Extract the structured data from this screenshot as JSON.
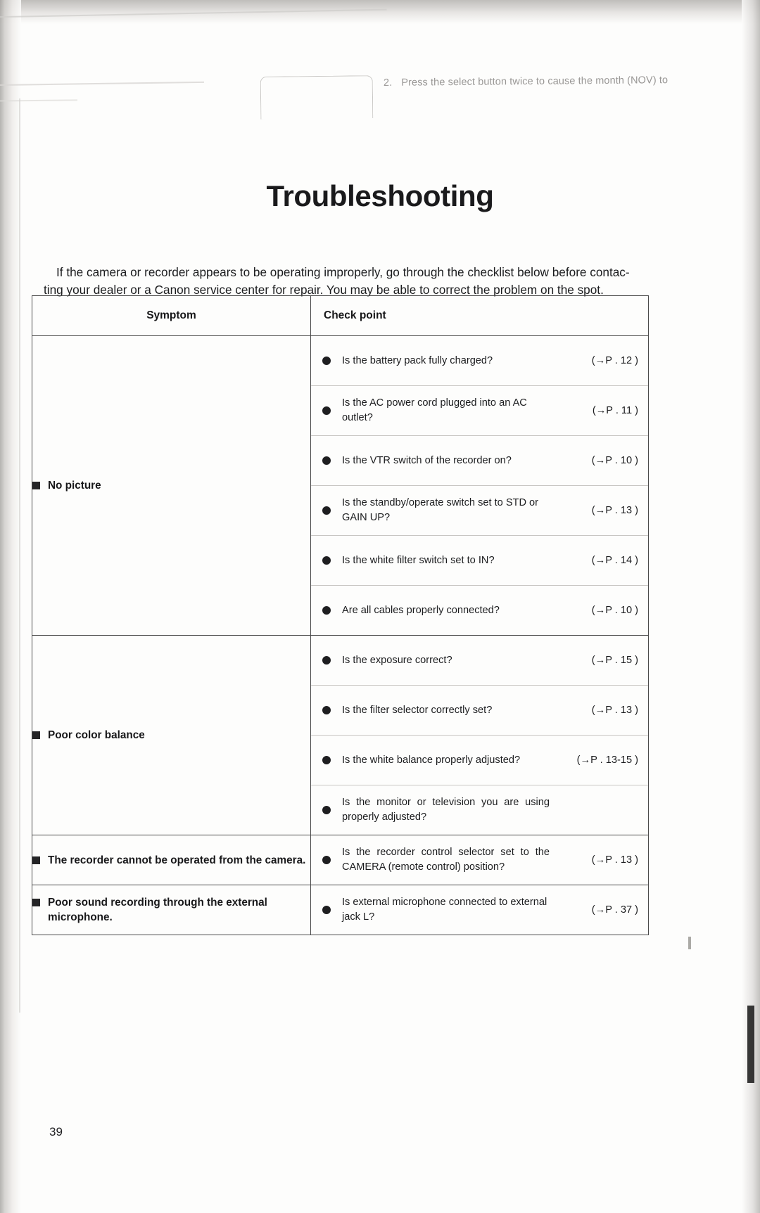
{
  "document": {
    "title": "Troubleshooting",
    "page_number": "39",
    "intro_line_1": "If the camera or recorder appears to be operating improperly, go through the checklist below before contac-",
    "intro_line_2": "ting your dealer or a Canon service center for repair. You may be able to correct the problem on the spot."
  },
  "bleed_through": {
    "number": "2.",
    "text": "Press the select button twice to cause the month (NOV) to"
  },
  "table": {
    "headers": {
      "symptom": "Symptom",
      "check_point": "Check point"
    },
    "rows": [
      {
        "symptom": "No picture",
        "checks": [
          {
            "text": "Is the battery pack fully charged?",
            "ref": "(→P . 12 )"
          },
          {
            "text": "Is the AC power cord plugged into an AC outlet?",
            "ref": "(→P . 11 )"
          },
          {
            "text": "Is the VTR switch of the recorder on?",
            "ref": "(→P . 10 )"
          },
          {
            "text": "Is the standby/operate switch set to STD or GAIN UP?",
            "ref": "(→P . 13 )"
          },
          {
            "text": "Is the white filter switch set to IN?",
            "ref": "(→P . 14 )"
          },
          {
            "text": "Are all cables properly connected?",
            "ref": "(→P . 10 )"
          }
        ]
      },
      {
        "symptom": "Poor color balance",
        "checks": [
          {
            "text": "Is the exposure correct?",
            "ref": "(→P . 15 )"
          },
          {
            "text": "Is the filter selector correctly set?",
            "ref": "(→P . 13 )"
          },
          {
            "text": "Is the white balance properly adjusted?",
            "ref": "(→P .  13-15 )"
          },
          {
            "text": "Is the monitor or television you are using properly adjusted?",
            "ref": ""
          }
        ]
      },
      {
        "symptom": "The recorder cannot be operated from the camera.",
        "checks": [
          {
            "text": "Is the recorder control selector set to the CAMERA (remote control) position?",
            "ref": "(→P . 13 )"
          }
        ]
      },
      {
        "symptom": "Poor sound recording through the external microphone.",
        "checks": [
          {
            "text": "Is external microphone connected to external jack L?",
            "ref": "(→P . 37 )"
          }
        ]
      }
    ]
  }
}
